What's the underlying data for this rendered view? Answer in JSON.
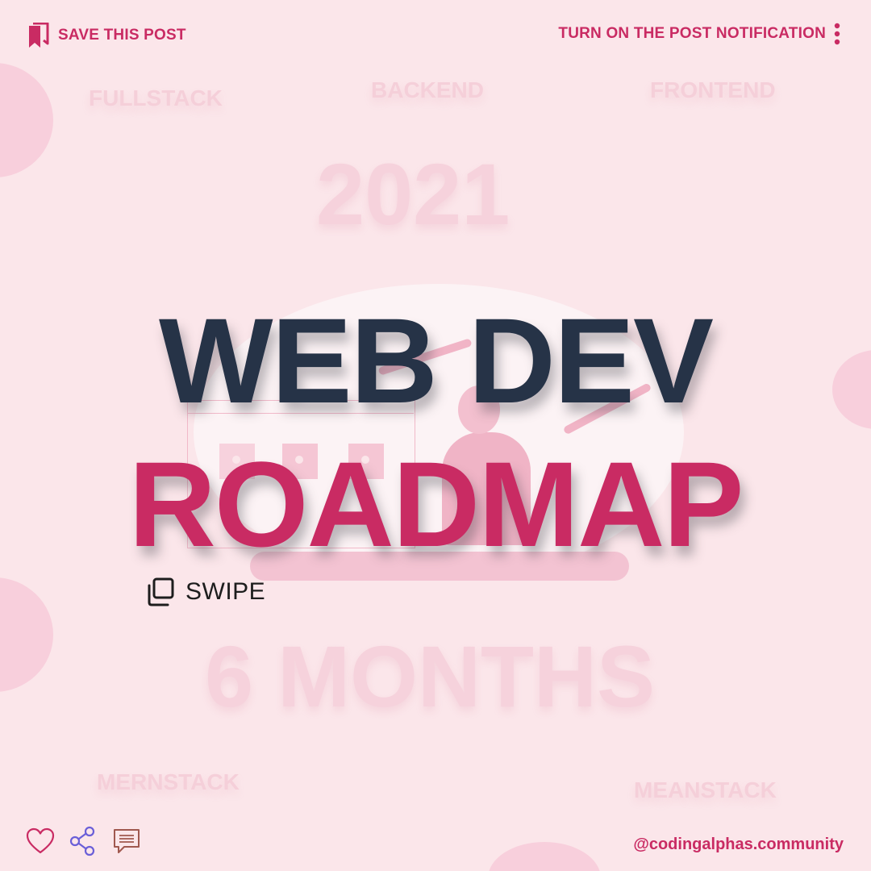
{
  "header": {
    "save_label": "SAVE THIS POST",
    "notification_label": "TURN ON THE POST NOTIFICATION"
  },
  "background_words": {
    "fullstack": "FULLSTACK",
    "backend": "BACKEND",
    "frontend": "FRONTEND",
    "year": "2021",
    "duration": "6 MONTHS",
    "mernstack": "MERNSTACK",
    "meanstack": "MEANSTACK"
  },
  "headline": {
    "line1": "WEB DEV",
    "line2": "ROADMAP"
  },
  "swipe": {
    "label": "SWIPE",
    "icon": "copy-stack-icon"
  },
  "footer": {
    "handle": "@codingalphas.community",
    "icons": [
      "heart-icon",
      "share-icon",
      "comment-icon"
    ]
  },
  "colors": {
    "background": "#fbe6ea",
    "accent": "#c92b63",
    "headline_dark": "#263347",
    "blob": "#f8cfdc"
  }
}
